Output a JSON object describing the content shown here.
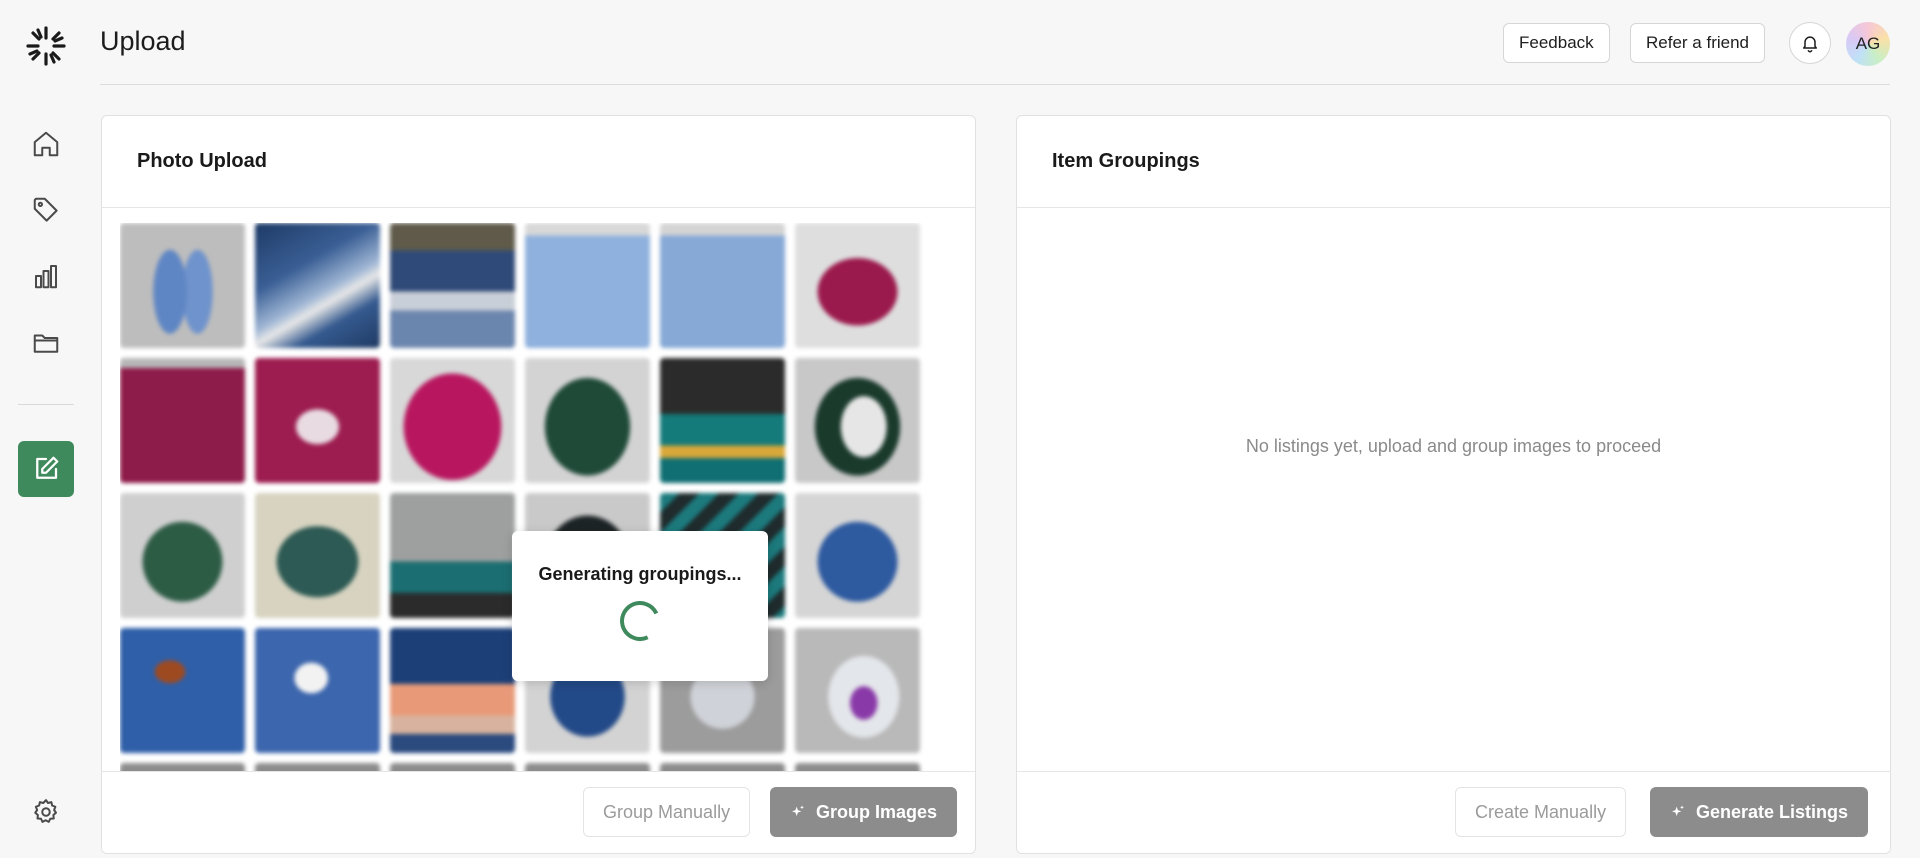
{
  "header": {
    "title": "Upload",
    "feedback_label": "Feedback",
    "refer_label": "Refer a friend",
    "avatar_initials": "AG"
  },
  "sidebar": {
    "items": [
      {
        "name": "home",
        "icon": "home-icon"
      },
      {
        "name": "listings",
        "icon": "tag-icon"
      },
      {
        "name": "analytics",
        "icon": "bar-chart-icon"
      },
      {
        "name": "files",
        "icon": "folder-icon"
      },
      {
        "name": "upload",
        "icon": "edit-icon",
        "active": true
      }
    ],
    "settings_icon": "gear-icon"
  },
  "photo_upload": {
    "title": "Photo Upload",
    "loading_text": "Generating groupings...",
    "group_manually_label": "Group Manually",
    "group_images_label": "Group Images"
  },
  "item_groupings": {
    "title": "Item Groupings",
    "empty_message": "No listings yet, upload and group images to proceed",
    "create_manually_label": "Create Manually",
    "generate_listings_label": "Generate Listings"
  },
  "colors": {
    "accent": "#3f8a5c",
    "disabled_button": "#8c8c8c",
    "background": "#f7f7f7"
  }
}
